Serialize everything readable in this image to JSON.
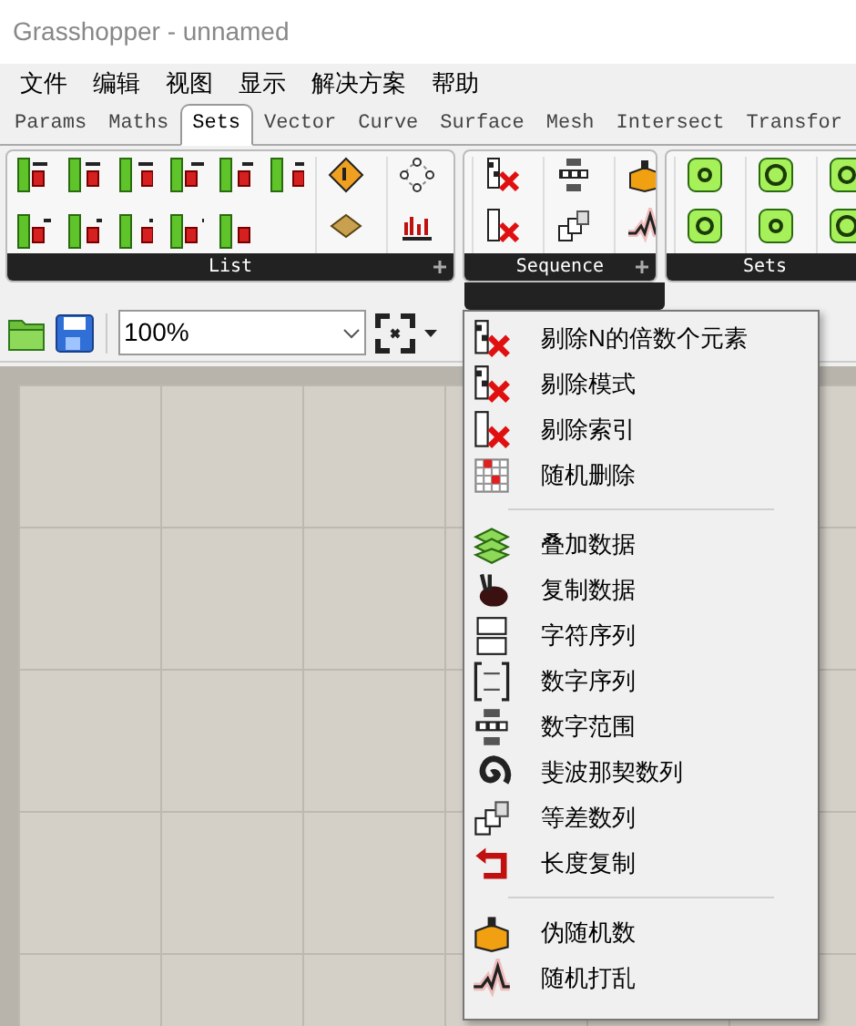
{
  "window": {
    "title": "Grasshopper - unnamed"
  },
  "menu_bar": [
    "文件",
    "编辑",
    "视图",
    "显示",
    "解决方案",
    "帮助"
  ],
  "tabs": [
    {
      "label": "Params",
      "selected": false
    },
    {
      "label": "Maths",
      "selected": false
    },
    {
      "label": "Sets",
      "selected": true
    },
    {
      "label": "Vector",
      "selected": false
    },
    {
      "label": "Curve",
      "selected": false
    },
    {
      "label": "Surface",
      "selected": false
    },
    {
      "label": "Mesh",
      "selected": false
    },
    {
      "label": "Intersect",
      "selected": false
    },
    {
      "label": "Transfor",
      "selected": false
    }
  ],
  "ribbon": {
    "panels": [
      {
        "label": "List"
      },
      {
        "label": "Sequence"
      },
      {
        "label": "Sets"
      }
    ]
  },
  "toolbar": {
    "zoom": "100%"
  },
  "dropdown_menu": {
    "items": [
      {
        "kind": "item",
        "label": "剔除N的倍数个元素"
      },
      {
        "kind": "item",
        "label": "剔除模式"
      },
      {
        "kind": "item",
        "label": "剔除索引"
      },
      {
        "kind": "item",
        "label": "随机删除"
      },
      {
        "kind": "separator"
      },
      {
        "kind": "item",
        "label": "叠加数据"
      },
      {
        "kind": "item",
        "label": "复制数据"
      },
      {
        "kind": "item",
        "label": "字符序列"
      },
      {
        "kind": "item",
        "label": "数字序列"
      },
      {
        "kind": "item",
        "label": "数字范围"
      },
      {
        "kind": "item",
        "label": "斐波那契数列"
      },
      {
        "kind": "item",
        "label": "等差数列"
      },
      {
        "kind": "item",
        "label": "长度复制"
      },
      {
        "kind": "separator"
      },
      {
        "kind": "item",
        "label": "伪随机数"
      },
      {
        "kind": "item",
        "label": "随机打乱"
      }
    ]
  }
}
